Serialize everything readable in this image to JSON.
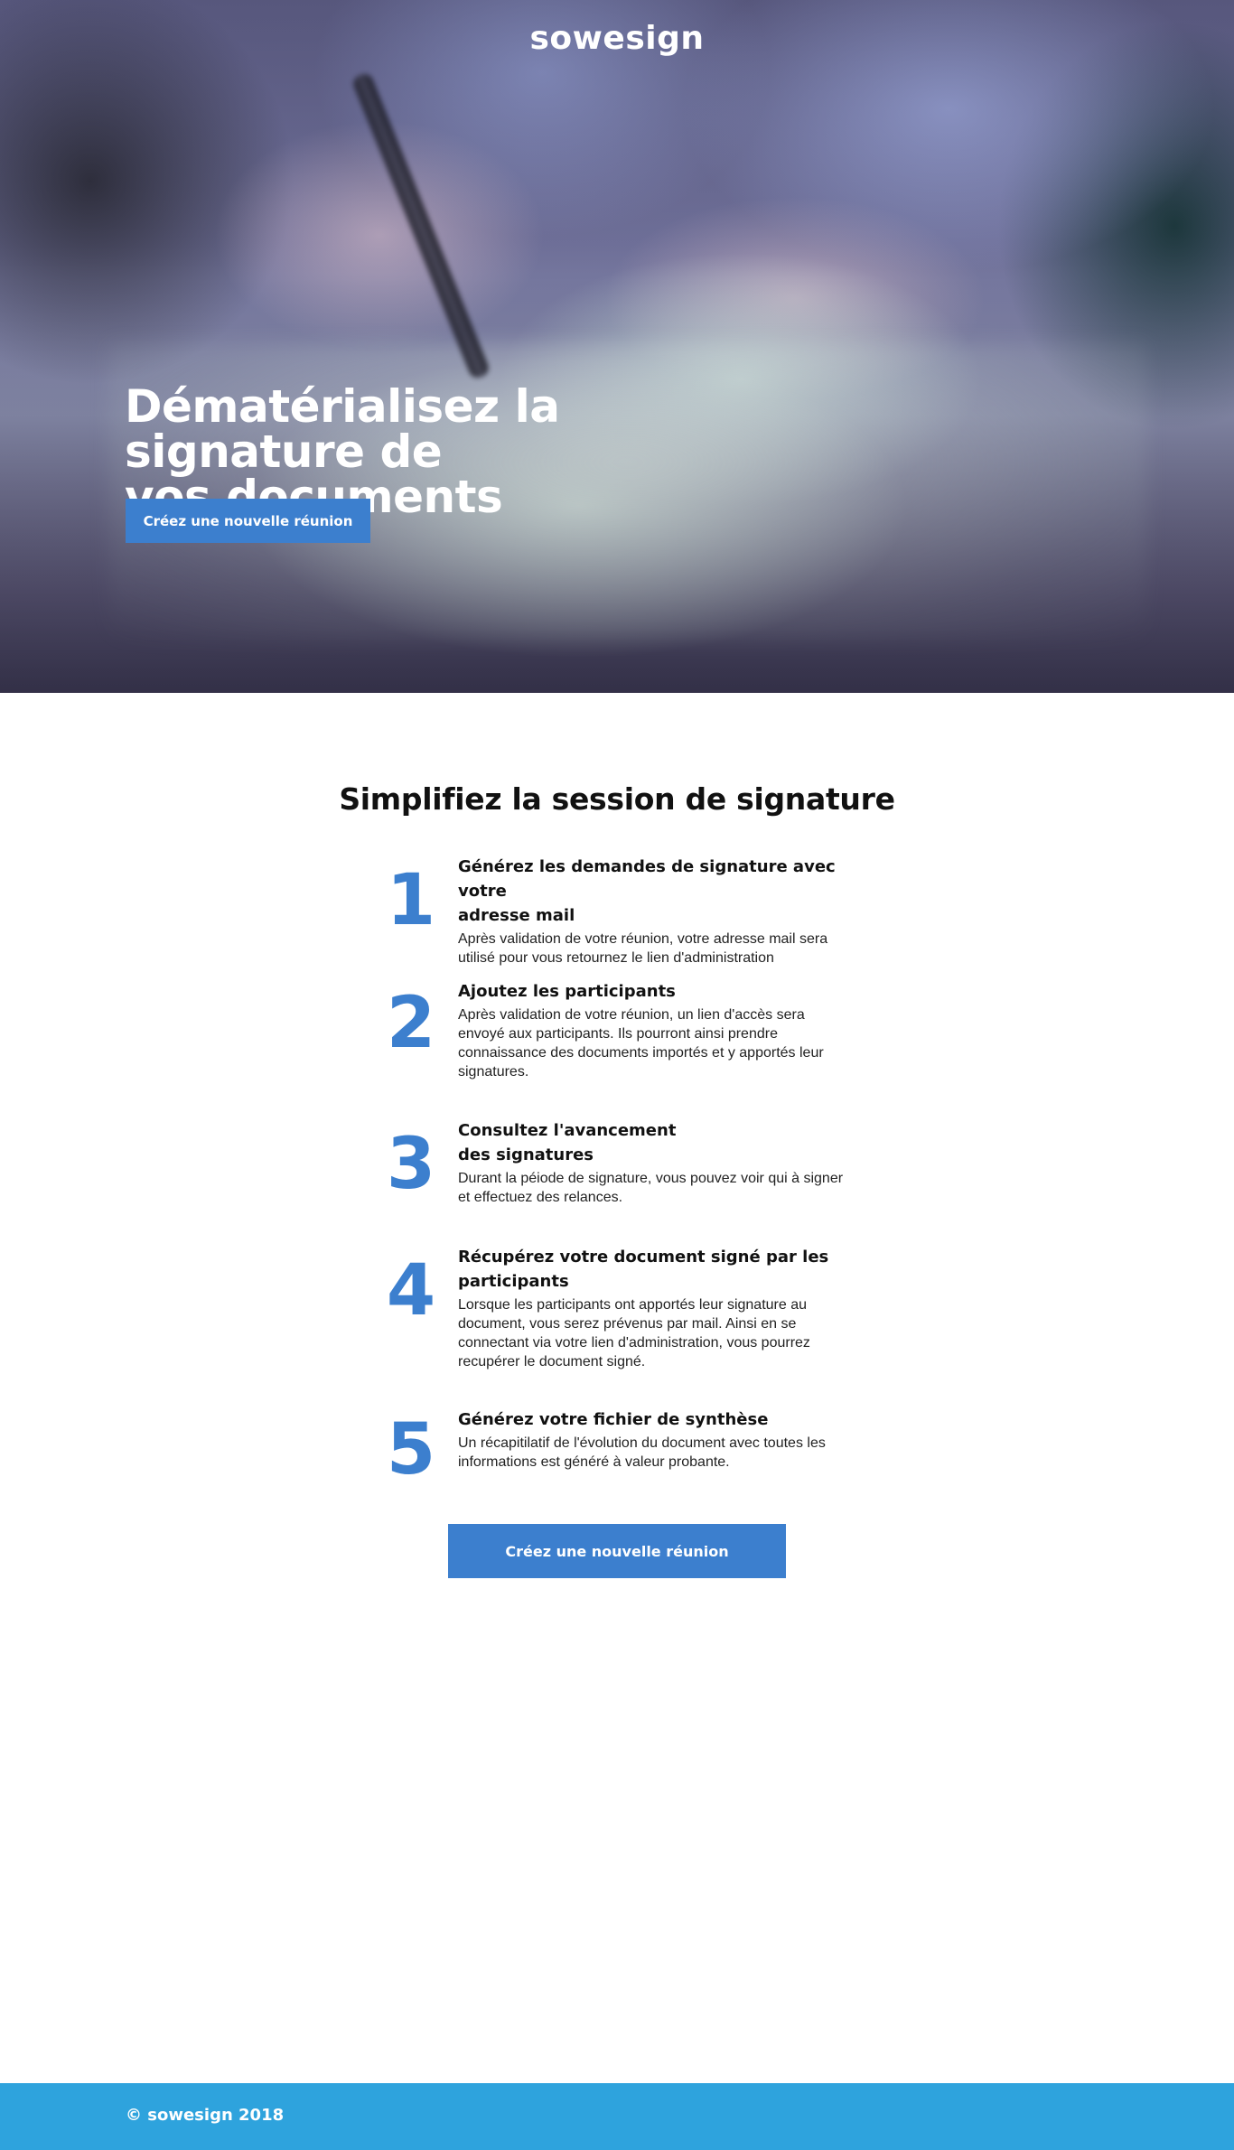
{
  "header": {
    "logo": "sowesign"
  },
  "hero": {
    "title_line1": "Dématérialisez la signature de",
    "title_line2": "vos documents",
    "cta_label": "Créez une nouvelle réunion"
  },
  "steps_section": {
    "title": "Simplifiez la session de signature",
    "steps": [
      {
        "number": "1",
        "title_line1": "Générez les demandes de signature avec votre",
        "title_line2": "adresse mail",
        "description_line1": "Après validation de votre réunion, votre adresse mail sera",
        "description_line2": "utilisé pour vous retournez le lien d'administration"
      },
      {
        "number": "2",
        "title_line1": "Ajoutez les participants",
        "description_line1": "Après validation de votre réunion, un lien d'accès sera",
        "description_line2": "envoyé aux participants. Ils pourront ainsi prendre",
        "description_line3": "connaissance des documents importés et y apportés leur",
        "description_line4": "signatures."
      },
      {
        "number": "3",
        "title_line1": "Consultez l'avancement",
        "title_line2": "des signatures",
        "description_line1": "Durant la péiode de signature, vous pouvez voir qui à signer",
        "description_line2": "et effectuez des relances."
      },
      {
        "number": "4",
        "title_line1": "Récupérez votre document signé par les",
        "title_line2": "participants",
        "description_line1": "Lorsque les participants ont apportés leur signature au",
        "description_line2": "document, vous serez prévenus par mail. Ainsi en se",
        "description_line3": "connectant via votre lien d'administration, vous pourrez",
        "description_line4": "recupérer le document signé."
      },
      {
        "number": "5",
        "title_line1": "Générez votre fichier de synthèse",
        "description_line1": "Un récapitilatif de l'évolution du document avec toutes les",
        "description_line2": "informations est généré à valeur probante."
      }
    ],
    "cta_label": "Créez une nouvelle réunion"
  },
  "footer": {
    "copyright": "© sowesign 2018"
  },
  "colors": {
    "accent": "#3c7fce",
    "footer": "#2ea3dd"
  }
}
